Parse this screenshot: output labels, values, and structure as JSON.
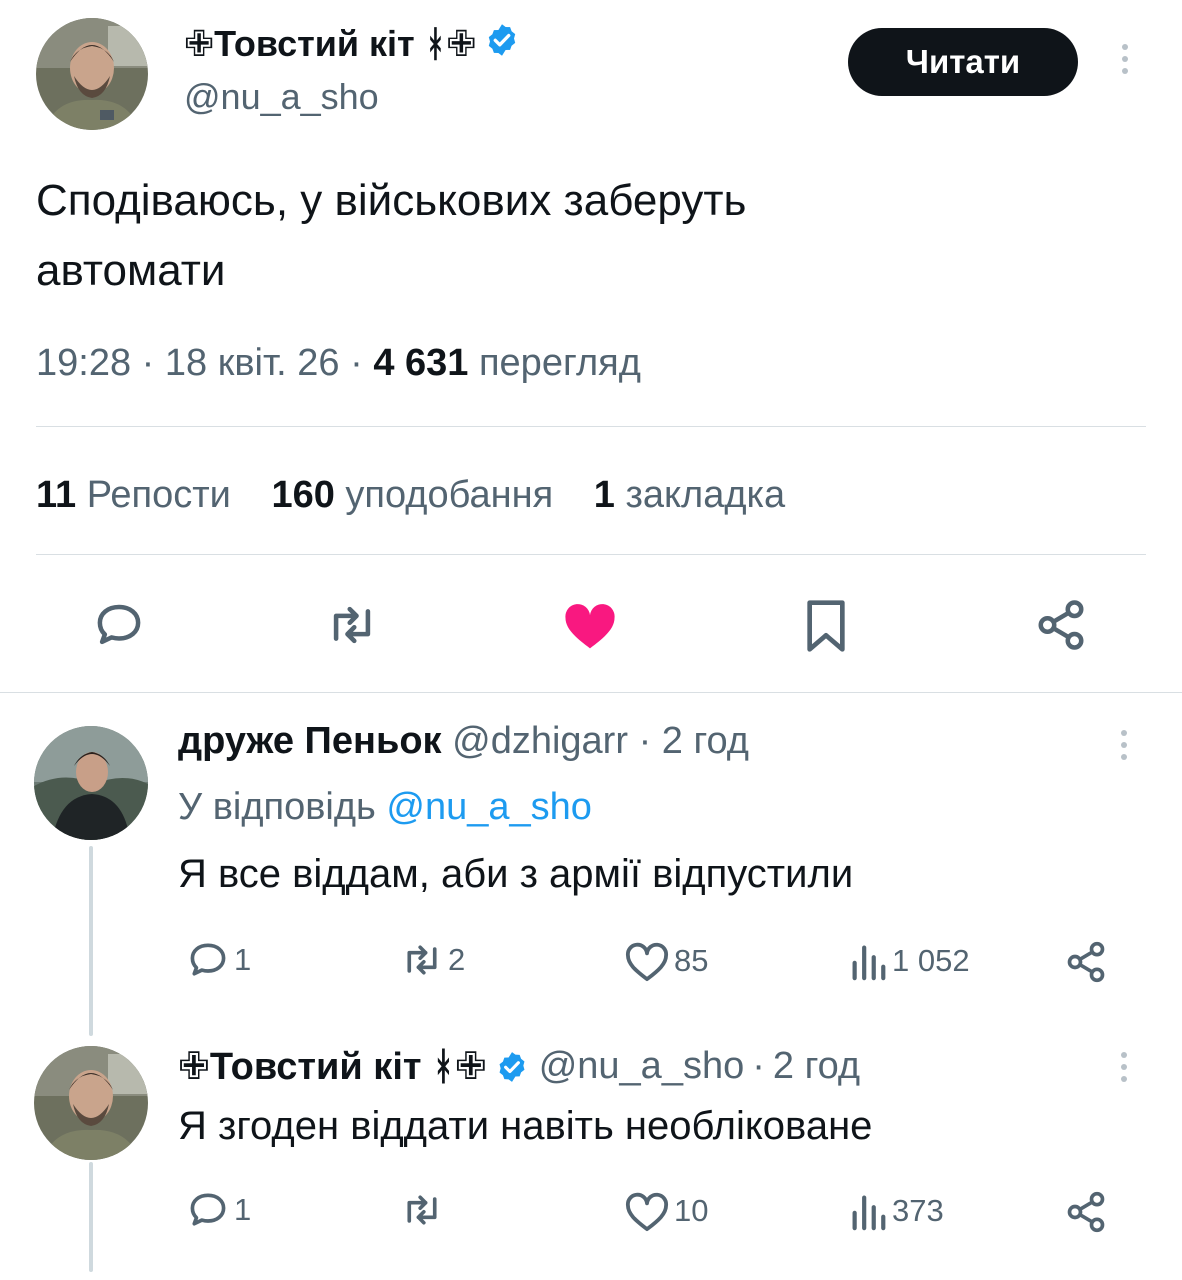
{
  "main_tweet": {
    "author_name": "✙Товстий кіт ᚼ✙",
    "handle": "@nu_a_sho",
    "follow_label": "Читати",
    "text_line1": "Сподіваюсь, у військових заберуть",
    "text_line2": "автомати",
    "time": "19:28",
    "date": "18 квіт. 26",
    "views_count": "4 631",
    "views_label": "перегляд",
    "reposts_count": "11",
    "reposts_label": "Репости",
    "likes_count": "160",
    "likes_label": "уподобання",
    "bookmarks_count": "1",
    "bookmarks_label": "закладка",
    "liked": true,
    "accent_like_color": "#f91880",
    "verified_color": "#1d9bf0"
  },
  "replies": [
    {
      "author_name": "друже Пеньок",
      "handle": "@dzhigarr",
      "age": "2 год",
      "reply_to_prefix": "У відповідь",
      "reply_to_handle": "@nu_a_sho",
      "text": "Я все віддам, аби з армії відпустили",
      "replies_count": "1",
      "reposts_count": "2",
      "likes_count": "85",
      "views_count": "1 052"
    },
    {
      "author_name": "✙Товстий кіт ᚼ✙",
      "handle": "@nu_a_sho",
      "age": "2 год",
      "text": "Я згоден віддати навіть необліковане",
      "replies_count": "1",
      "reposts_count": "",
      "likes_count": "10",
      "views_count": "373"
    }
  ],
  "sep": "·",
  "icons": {
    "reply": "speech-bubble-icon",
    "repost": "repost-arrows-icon",
    "like": "heart-icon",
    "bookmark": "bookmark-icon",
    "share": "share-nodes-icon",
    "views": "bar-chart-icon",
    "more": "vertical-dots-icon",
    "verified": "verified-badge-icon"
  }
}
